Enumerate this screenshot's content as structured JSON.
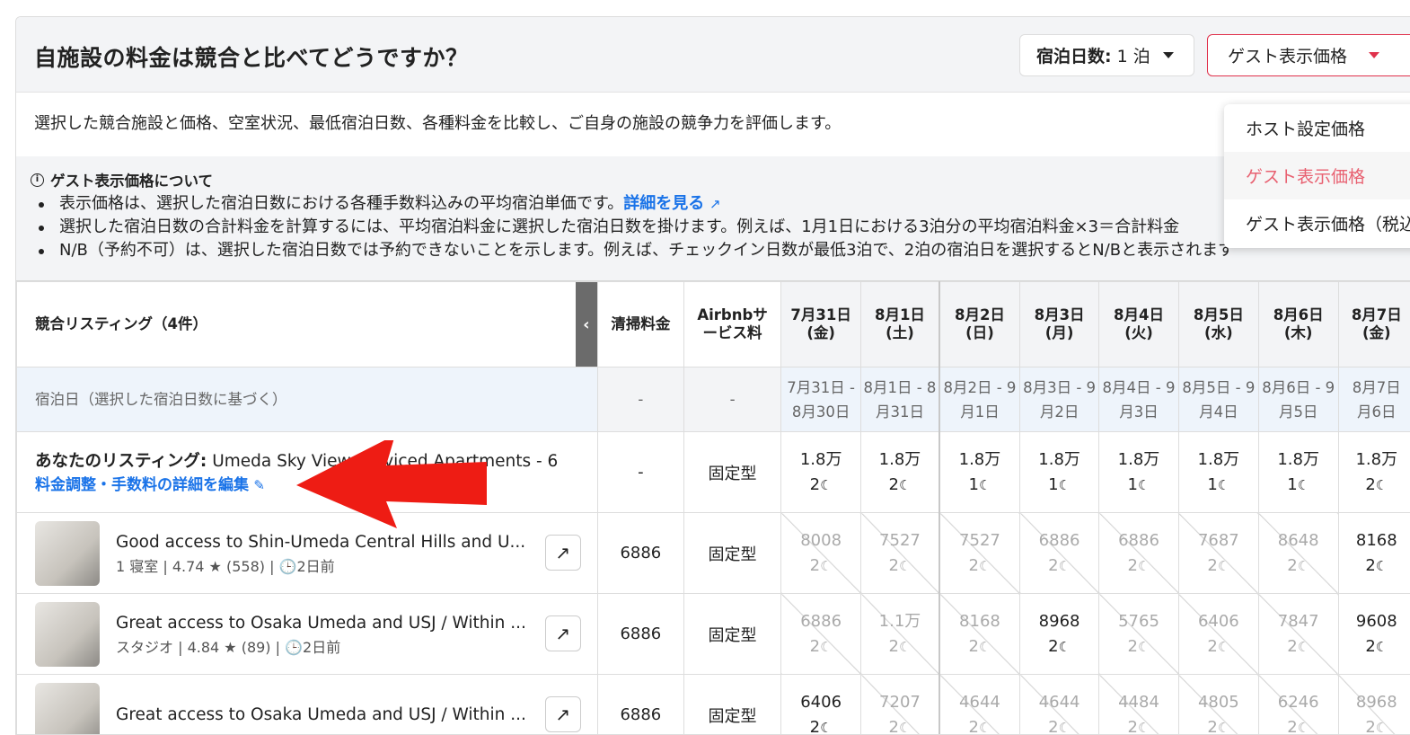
{
  "header": {
    "title": "自施設の料金は競合と比べてどうですか？",
    "nights_label": "宿泊日数:",
    "nights_value": "1 泊",
    "price_type": "ゲスト表示価格"
  },
  "description": "選択した競合施設と価格、空室状況、最低宿泊日数、各種料金を比較し、ご自身の施設の競争力を評価します。",
  "note": {
    "title": "ゲスト表示価格について",
    "items": [
      {
        "text": "表示価格は、選択した宿泊日数における各種手数料込みの平均宿泊単価です。",
        "link": "詳細を見る"
      },
      {
        "text": "選択した宿泊日数の合計料金を計算するには、平均宿泊料金に選択した宿泊日数を掛けます。例えば、1月1日における3泊分の平均宿泊料金×3＝合計料金"
      },
      {
        "text": "N/B（予約不可）は、選択した宿泊日数では予約できないことを示します。例えば、チェックイン日数が最低3泊で、2泊の宿泊日を選択するとN/Bと表示されます"
      }
    ]
  },
  "menu": {
    "items": [
      "ホスト設定価格",
      "ゲスト表示価格",
      "ゲスト表示価格（税込）"
    ],
    "active": 1
  },
  "table": {
    "headers": {
      "listing": "競合リスティング（4件）",
      "cleaning": "清掃料金",
      "airbnb": "Airbnbサービス料",
      "airbnb_l1": "Airbnbサ",
      "airbnb_l2": "ービス料"
    },
    "dates": [
      {
        "d": "7月31日",
        "w": "(金)",
        "range1": "7月31日 -",
        "range2": "8月30日"
      },
      {
        "d": "8月1日",
        "w": "(土)",
        "range1": "8月1日 - 8",
        "range2": "月31日"
      },
      {
        "d": "8月2日",
        "w": "(日)",
        "range1": "8月2日 - 9",
        "range2": "月1日"
      },
      {
        "d": "8月3日",
        "w": "(月)",
        "range1": "8月3日 - 9",
        "range2": "月2日"
      },
      {
        "d": "8月4日",
        "w": "(火)",
        "range1": "8月4日 - 9",
        "range2": "月3日"
      },
      {
        "d": "8月5日",
        "w": "(水)",
        "range1": "8月5日 - 9",
        "range2": "月4日"
      },
      {
        "d": "8月6日",
        "w": "(木)",
        "range1": "8月6日 - 9",
        "range2": "月5日"
      },
      {
        "d": "8月7日",
        "w": "(金)",
        "range1": "8月7日",
        "range2": "月6日"
      }
    ],
    "stay_row": {
      "label": "宿泊日（選択した宿泊日数に基づく）",
      "cleaning": "-",
      "airbnb": "-"
    },
    "my_listing": {
      "label": "あなたのリスティング:",
      "name": "Umeda Sky View Serviced Apartments - 6",
      "edit_link": "料金調整・手数料の詳細を編集",
      "cleaning": "-",
      "airbnb": "固定型",
      "prices": [
        [
          "1.8万",
          "2"
        ],
        [
          "1.8万",
          "2"
        ],
        [
          "1.8万",
          "1"
        ],
        [
          "1.8万",
          "1"
        ],
        [
          "1.8万",
          "1"
        ],
        [
          "1.8万",
          "1"
        ],
        [
          "1.8万",
          "1"
        ],
        [
          "1.8万",
          "2"
        ]
      ]
    },
    "listings": [
      {
        "name": "Good access to Shin-Umeda Central Hills and U...",
        "meta": "1 寝室 | 4.74 ★ (558) | 🕒2日前",
        "cleaning": "6886",
        "airbnb": "固定型",
        "prices": [
          [
            "8008",
            "2"
          ],
          [
            "7527",
            "2"
          ],
          [
            "7527",
            "2"
          ],
          [
            "6886",
            "2"
          ],
          [
            "6886",
            "2"
          ],
          [
            "7687",
            "2"
          ],
          [
            "8648",
            "2"
          ],
          [
            "8168",
            "2"
          ]
        ],
        "available": [
          false,
          false,
          false,
          false,
          false,
          false,
          false,
          true
        ]
      },
      {
        "name": "Great access to Osaka Umeda and USJ / Within ...",
        "meta": "スタジオ | 4.84 ★ (89) | 🕒2日前",
        "cleaning": "6886",
        "airbnb": "固定型",
        "prices": [
          [
            "6886",
            "2"
          ],
          [
            "1.1万",
            "2"
          ],
          [
            "8168",
            "2"
          ],
          [
            "8968",
            "2"
          ],
          [
            "5765",
            "2"
          ],
          [
            "6406",
            "2"
          ],
          [
            "7847",
            "2"
          ],
          [
            "9608",
            "2"
          ]
        ],
        "available": [
          false,
          false,
          false,
          true,
          false,
          false,
          false,
          true
        ]
      },
      {
        "name": "Great access to Osaka Umeda and USJ / Within ...",
        "meta": "",
        "cleaning": "6886",
        "airbnb": "固定型",
        "prices": [
          [
            "6406",
            "2"
          ],
          [
            "7207",
            "2"
          ],
          [
            "4644",
            "2"
          ],
          [
            "4644",
            "2"
          ],
          [
            "4484",
            "2"
          ],
          [
            "4805",
            "2"
          ],
          [
            "6246",
            "2"
          ],
          [
            "8968",
            "2"
          ]
        ],
        "available": [
          true,
          false,
          false,
          false,
          false,
          false,
          false,
          false
        ]
      }
    ]
  },
  "colors": {
    "accent": "#e0324c",
    "link": "#1a73e8",
    "arrow": "#ee1c14"
  }
}
